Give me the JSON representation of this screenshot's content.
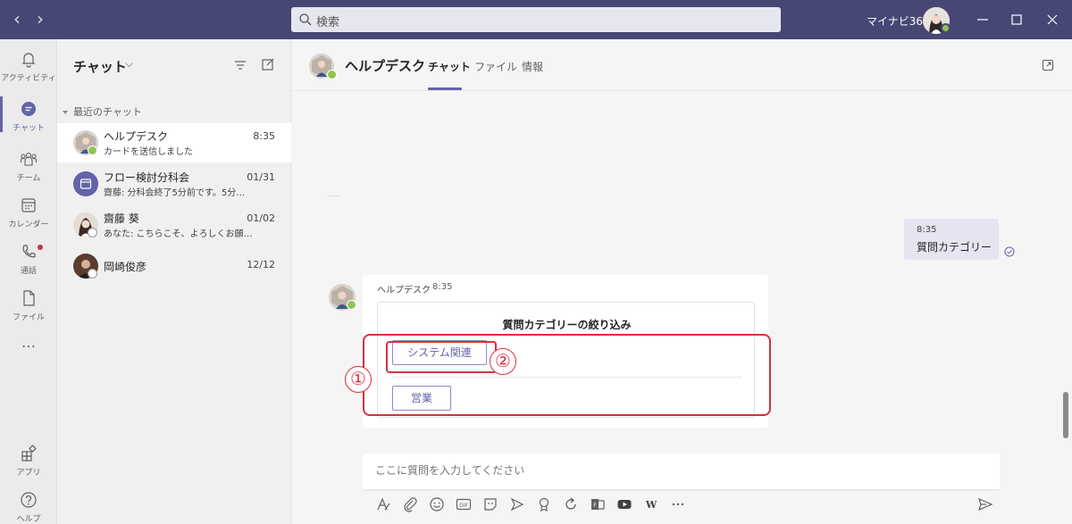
{
  "titlebar": {
    "search_placeholder": "検索",
    "org_name": "マイナビ365"
  },
  "rail": {
    "items": [
      {
        "label": "アクティビティ",
        "icon": "bell-icon"
      },
      {
        "label": "チャット",
        "icon": "chat-icon"
      },
      {
        "label": "チーム",
        "icon": "teams-icon"
      },
      {
        "label": "カレンダー",
        "icon": "calendar-icon"
      },
      {
        "label": "通話",
        "icon": "phone-icon"
      },
      {
        "label": "ファイル",
        "icon": "file-icon"
      },
      {
        "label": "アプリ",
        "icon": "apps-icon"
      },
      {
        "label": "ヘルプ",
        "icon": "help-icon"
      }
    ],
    "more": "…"
  },
  "chatlist": {
    "title": "チャット",
    "section": "最近のチャット",
    "chats": [
      {
        "name": "ヘルプデスク",
        "preview": "カードを送信しました",
        "time": "8:35"
      },
      {
        "name": "フロー検討分科会",
        "preview": "齋藤: 分科会終了5分前です。5分…",
        "time": "01/31"
      },
      {
        "name": "齋藤 葵",
        "preview": "あなた: こちらこそ、よろしくお願いします。",
        "time": "01/02"
      },
      {
        "name": "岡崎俊彦",
        "preview": "",
        "time": "12/12"
      }
    ]
  },
  "header": {
    "title": "ヘルプデスク",
    "tabs": [
      "チャット",
      "ファイル",
      "情報"
    ]
  },
  "messages": {
    "mine": {
      "time": "8:35",
      "text": "質問カテゴリー"
    },
    "bot": {
      "sender": "ヘルプデスク",
      "time": "8:35",
      "card_title": "質問カテゴリーの絞り込み",
      "buttons": [
        "システム関連",
        "営業"
      ]
    }
  },
  "annotations": [
    "①",
    "②"
  ],
  "compose": {
    "placeholder": "ここに質問を入力してください",
    "tools": [
      "format-icon",
      "attach-icon",
      "emoji-icon",
      "gif-icon",
      "sticker-icon",
      "meet-icon",
      "praise-icon",
      "loop-icon",
      "forms-icon",
      "youtube-icon",
      "wiki-icon",
      "more-icon"
    ]
  },
  "colors": {
    "titlebar": "#464775",
    "accent": "#6264a7",
    "status_available": "#92c353",
    "annotation": "#d9303d"
  }
}
